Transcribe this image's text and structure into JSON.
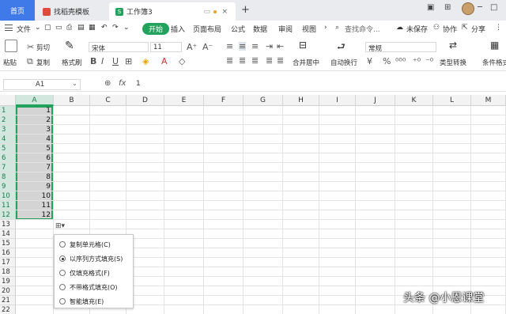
{
  "tabs": {
    "home": "首页",
    "template": "找稻壳模板",
    "workbook": "工作簿3",
    "new_tab": "+"
  },
  "menu": {
    "file": "文件",
    "items": [
      "开始",
      "插入",
      "页面布局",
      "公式",
      "数据",
      "审阅",
      "视图"
    ],
    "search": "查找命令...",
    "unsaved": "未保存",
    "collab": "协作",
    "share": "分享"
  },
  "toolbar": {
    "paste": "粘贴",
    "cut": "剪切",
    "copy": "复制",
    "format_painter": "格式刷",
    "font_name": "宋体",
    "font_size": "11",
    "merge_center": "合并居中",
    "auto_wrap": "自动换行",
    "number_format": "常规",
    "type_convert": "类型转换",
    "cond_format": "条件格式"
  },
  "formula_bar": {
    "cell_ref": "A1",
    "fx": "fx",
    "value": "1"
  },
  "grid": {
    "columns": [
      "A",
      "B",
      "C",
      "D",
      "E",
      "F",
      "G",
      "H",
      "I",
      "J",
      "K",
      "L",
      "M"
    ],
    "rows": [
      "1",
      "2",
      "3",
      "4",
      "5",
      "6",
      "7",
      "8",
      "9",
      "10",
      "11",
      "12",
      "13",
      "14",
      "15",
      "16",
      "17",
      "18",
      "19",
      "20",
      "21",
      "22"
    ],
    "column_a_values": [
      "1",
      "2",
      "3",
      "4",
      "5",
      "6",
      "7",
      "8",
      "9",
      "10",
      "11",
      "12"
    ],
    "selected_column": "A"
  },
  "autofill_menu": {
    "options": [
      "复制单元格(C)",
      "以序列方式填充(S)",
      "仅填充格式(F)",
      "不带格式填充(O)",
      "智能填充(E)"
    ],
    "selected_index": 1
  },
  "watermark": "头条 @小恩课堂",
  "accent_color": "#21a35e"
}
